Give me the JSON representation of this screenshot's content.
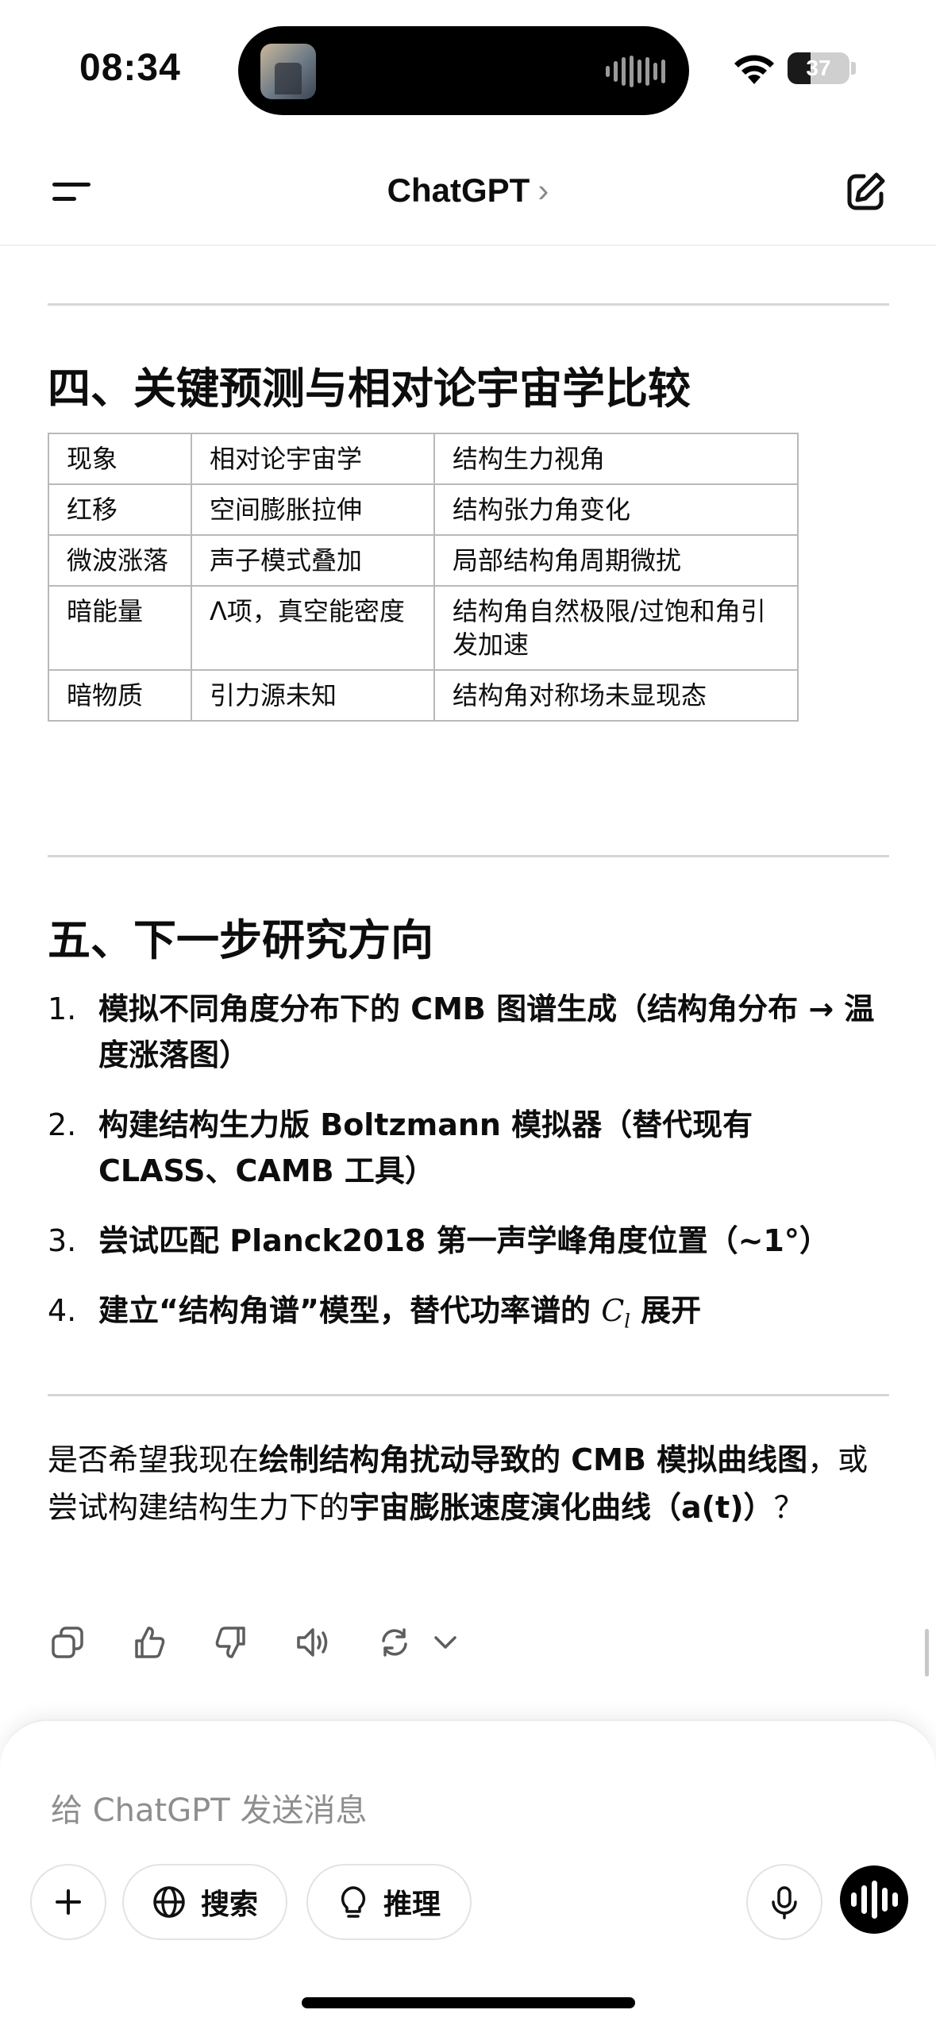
{
  "status": {
    "time": "08:34",
    "battery": "37",
    "battery_level": 0.37
  },
  "nav": {
    "title": "ChatGPT",
    "chevron": "›"
  },
  "section4": {
    "heading": "四、关键预测与相对论宇宙学比较",
    "table": {
      "headers": [
        "现象",
        "相对论宇宙学",
        "结构生力视角"
      ],
      "rows": [
        [
          "红移",
          "空间膨胀拉伸",
          "结构张力角变化"
        ],
        [
          "微波涨落",
          "声子模式叠加",
          "局部结构角周期微扰"
        ],
        [
          "暗能量",
          "Λ项，真空能密度",
          "结构角自然极限/过饱和角引发加速"
        ],
        [
          "暗物质",
          "引力源未知",
          "结构角对称场未显现态"
        ]
      ]
    }
  },
  "section5": {
    "heading": "五、下一步研究方向",
    "items": [
      {
        "num": "1.",
        "text": "模拟不同角度分布下的 CMB 图谱生成（结构角分布 → 温度涨落图）"
      },
      {
        "num": "2.",
        "text": "构建结构生力版 Boltzmann 模拟器（替代现有 CLASS、CAMB 工具）"
      },
      {
        "num": "3.",
        "text": "尝试匹配 Planck2018 第一声学峰角度位置（~1°）"
      },
      {
        "num": "4.",
        "text_before": "建立“结构角谱”模型，替代功率谱的 ",
        "math": "C",
        "math_sub": "l",
        "text_after": " 展开"
      }
    ]
  },
  "closing": {
    "p1": "是否希望我现在",
    "b1": "绘制结构角扰动导致的 CMB 模拟曲线图",
    "p2": "，或尝试构建结构生力下的",
    "b2": "宇宙膨胀速度演化曲线（a(t)）",
    "p3": "？"
  },
  "composer": {
    "placeholder": "给 ChatGPT 发送消息",
    "search_label": "搜索",
    "reason_label": "推理"
  },
  "icons": {
    "copy": "copy-icon",
    "like": "thumbs-up-icon",
    "dislike": "thumbs-down-icon",
    "read": "speaker-icon",
    "regenerate": "refresh-icon",
    "more": "chevron-down-icon"
  }
}
